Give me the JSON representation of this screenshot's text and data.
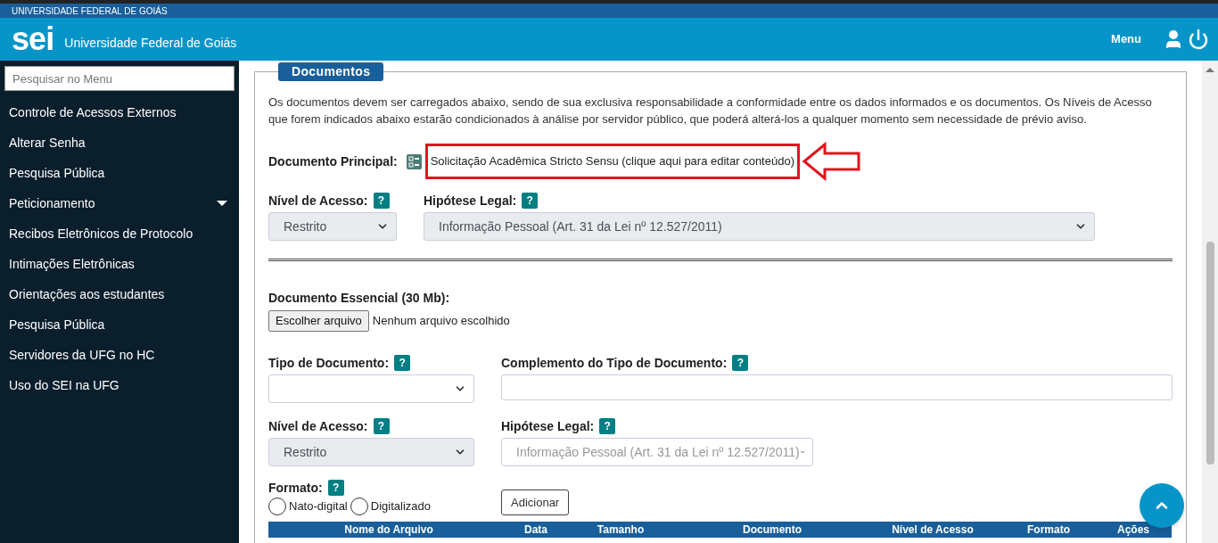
{
  "top_strip": {
    "title": "UNIVERSIDADE FEDERAL DE GOIÁS"
  },
  "header": {
    "logo": "sei",
    "org": "Universidade Federal de Goiás",
    "menu": "Menu"
  },
  "sidebar": {
    "search": {
      "placeholder": "Pesquisar no Menu"
    },
    "items": [
      {
        "label": "Controle de Acessos Externos"
      },
      {
        "label": "Alterar Senha"
      },
      {
        "label": "Pesquisa Pública"
      },
      {
        "label": "Peticionamento",
        "expanded": false
      },
      {
        "label": "Recibos Eletrônicos de Protocolo"
      },
      {
        "label": "Intimações Eletrônicas"
      },
      {
        "label": "Orientações aos estudantes"
      },
      {
        "label": "Pesquisa Pública"
      },
      {
        "label": "Servidores da UFG no HC"
      },
      {
        "label": "Uso do SEI na UFG"
      }
    ]
  },
  "documentos": {
    "legend": "Documentos",
    "intro": "Os documentos devem ser carregados abaixo, sendo de sua exclusiva responsabilidade a conformidade entre os dados informados e os documentos. Os Níveis de Acesso que forem indicados abaixo estarão condicionados à análise por servidor público, que poderá alterá-los a qualquer momento sem necessidade de prévio aviso.",
    "principal": {
      "label": "Documento Principal:",
      "link": "Solicitação Acadêmica Stricto Sensu (clique aqui para editar conteúdo)"
    },
    "principal_access": [
      {
        "label": "Nível de Acesso:",
        "help": "?",
        "value": "Restrito",
        "disabled": true
      },
      {
        "label": "Hipótese Legal:",
        "help": "?",
        "value": "Informação Pessoal (Art. 31 da Lei nº 12.527/2011)",
        "disabled": true
      }
    ],
    "essencial": {
      "label": "Documento Essencial (30 Mb):",
      "button": "Escolher arquivo",
      "status": "Nenhum arquivo escolhido"
    },
    "tipo": {
      "label": "Tipo de Documento:",
      "help": "?"
    },
    "complemento": {
      "label": "Complemento do Tipo de Documento:",
      "help": "?"
    },
    "access": [
      {
        "label": "Nível de Acesso:",
        "help": "?",
        "value": "Restrito",
        "disabled": true
      },
      {
        "label": "Hipótese Legal:",
        "help": "?",
        "value": "Informação Pessoal (Art. 31 da Lei nº 12.527/2011)",
        "disabled": false,
        "muted": true
      }
    ],
    "formato": {
      "label": "Formato:",
      "help": "?",
      "options": [
        {
          "label": "Nato-digital",
          "selected": false
        },
        {
          "label": "Digitalizado",
          "selected": false
        }
      ]
    },
    "add_button": "Adicionar",
    "table": {
      "columns": [
        "Nome do Arquivo",
        "Data",
        "Tamanho",
        "Documento",
        "Nível de Acesso",
        "Formato",
        "Ações"
      ]
    }
  }
}
